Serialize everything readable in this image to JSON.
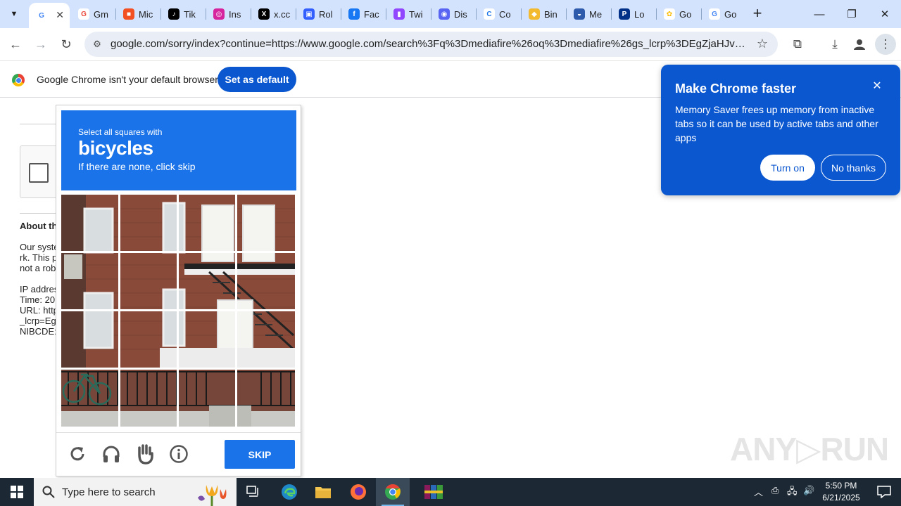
{
  "tabs": [
    {
      "label": "",
      "fav": "G",
      "favbg": "#ffffff",
      "favfg": "#4285f4",
      "active": true
    },
    {
      "label": "Gm",
      "fav": "G",
      "favbg": "#ffffff",
      "favfg": "#ea4335"
    },
    {
      "label": "Mic",
      "fav": "■",
      "favbg": "#f25022",
      "favfg": "#ffffff"
    },
    {
      "label": "Tik",
      "fav": "♪",
      "favbg": "#000000",
      "favfg": "#ffffff"
    },
    {
      "label": "Ins",
      "fav": "◎",
      "favbg": "#d6249f",
      "favfg": "#ffffff"
    },
    {
      "label": "x.cc",
      "fav": "X",
      "favbg": "#000000",
      "favfg": "#ffffff"
    },
    {
      "label": "Rol",
      "fav": "▣",
      "favbg": "#335fff",
      "favfg": "#ffffff"
    },
    {
      "label": "Fac",
      "fav": "f",
      "favbg": "#1877f2",
      "favfg": "#ffffff"
    },
    {
      "label": "Twi",
      "fav": "▮",
      "favbg": "#9146ff",
      "favfg": "#ffffff"
    },
    {
      "label": "Dis",
      "fav": "◉",
      "favbg": "#5865f2",
      "favfg": "#ffffff"
    },
    {
      "label": "Co",
      "fav": "C",
      "favbg": "#ffffff",
      "favfg": "#1a73e8"
    },
    {
      "label": "Bin",
      "fav": "◆",
      "favbg": "#f3ba2f",
      "favfg": "#ffffff"
    },
    {
      "label": "Me",
      "fav": "◒",
      "favbg": "#2e5aac",
      "favfg": "#ffffff"
    },
    {
      "label": "Lo",
      "fav": "P",
      "favbg": "#003087",
      "favfg": "#ffffff"
    },
    {
      "label": "Go",
      "fav": "✿",
      "favbg": "#ffffff",
      "favfg": "#fbbc04"
    },
    {
      "label": "Go",
      "fav": "G",
      "favbg": "#ffffff",
      "favfg": "#4285f4"
    }
  ],
  "toolbar": {
    "url": "google.com/sorry/index?continue=https://www.google.com/search%3Fq%3Dmediafire%26oq%3Dmediafire%26gs_lcrp%3DEgZjaHJvbWUyBggA..."
  },
  "infobar": {
    "message": "Google Chrome isn't your default browser",
    "button": "Set as default"
  },
  "page": {
    "about": "About th",
    "lines": [
      "Our syste",
      "rk. This p",
      "not a rob"
    ],
    "meta": [
      "IP addres",
      "Time: 20",
      "URL: http",
      "_lcrp=Eg",
      "NIBCDE:"
    ]
  },
  "captcha": {
    "instruction": "Select all squares with",
    "target": "bicycles",
    "hint": "If there are none, click skip",
    "skip": "SKIP"
  },
  "bubble": {
    "title": "Make Chrome faster",
    "body": "Memory Saver frees up memory from inactive tabs so it can be used by active tabs and other apps",
    "primary": "Turn on",
    "secondary": "No thanks"
  },
  "watermark": "ANY▷RUN",
  "taskbar": {
    "search_placeholder": "Type here to search",
    "time": "5:50 PM",
    "date": "6/21/2025"
  },
  "colors": {
    "tabstrip": "#d3e3fd",
    "accent": "#0b57d0",
    "captcha_blue": "#1a73e8",
    "taskbar": "#1c2833"
  }
}
